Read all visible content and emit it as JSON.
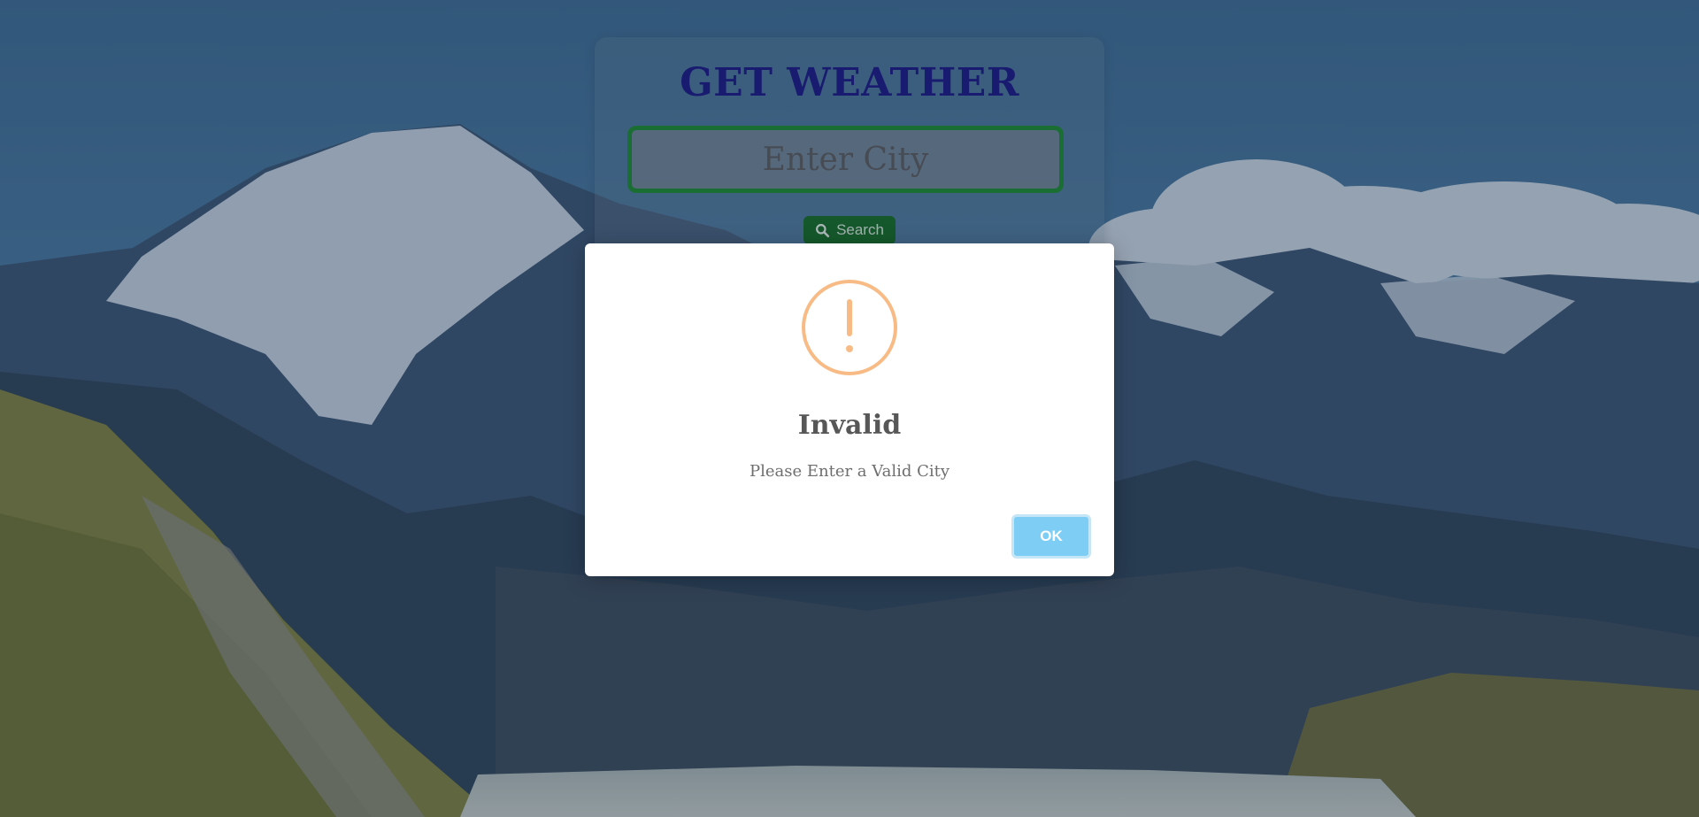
{
  "app": {
    "title": "GET WEATHER"
  },
  "search": {
    "placeholder": "Enter City",
    "value": "",
    "button_label": "Search",
    "button_icon": "search-icon"
  },
  "alert": {
    "icon": "warning-icon",
    "title": "Invalid",
    "message": "Please Enter a Valid City",
    "confirm_label": "OK"
  },
  "colors": {
    "title": "#1a1780",
    "input_border": "#1d8a2e",
    "search_button": "#166b22",
    "warning_icon": "#f8bb86",
    "ok_button": "#7dcdf5"
  }
}
